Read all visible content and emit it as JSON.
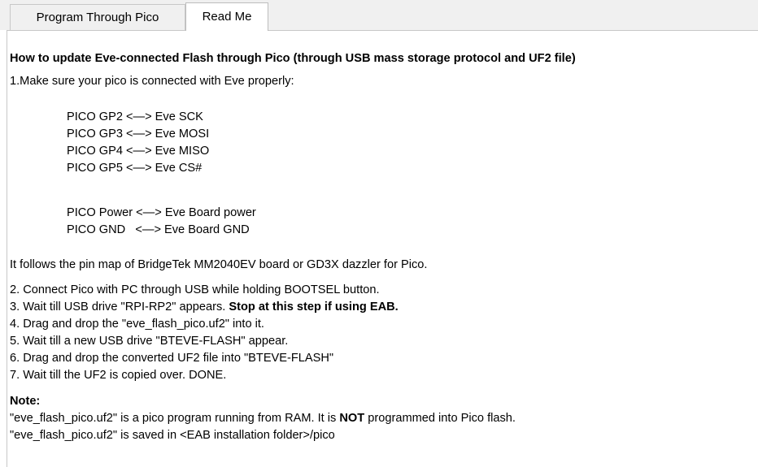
{
  "tabs": [
    {
      "label": "Program Through Pico",
      "active": false
    },
    {
      "label": "Read Me",
      "active": true
    }
  ],
  "readme": {
    "heading": "How to update Eve-connected Flash through Pico (through USB mass storage protocol and UF2 file)",
    "step1": "1.Make sure your pico is connected with Eve properly:",
    "pins": [
      "PICO GP2 <—> Eve SCK",
      "PICO GP3 <—> Eve MOSI",
      "PICO GP4 <—> Eve MISO",
      "PICO GP5 <—> Eve CS#"
    ],
    "power_pins": [
      "PICO Power <—> Eve Board power",
      "PICO GND   <—> Eve Board GND"
    ],
    "pin_map_note": "It follows the pin map of BridgeTek MM2040EV board or GD3X dazzler for Pico.",
    "step2": "2. Connect Pico with PC through USB while holding BOOTSEL button.",
    "step3_text": "3. Wait till USB drive \"RPI-RP2\" appears. ",
    "step3_bold": "Stop at this step if using EAB.",
    "step4": "4. Drag and drop the \"eve_flash_pico.uf2\" into it.",
    "step5": "5. Wait till a new USB drive \"BTEVE-FLASH\" appear.",
    "step6": "6. Drag and drop the converted UF2 file into \"BTEVE-FLASH\"",
    "step7": "7. Wait till the UF2 is copied over. DONE.",
    "note_label": "Note:",
    "note1_pre": "\"eve_flash_pico.uf2\" is a pico program running from RAM. It is ",
    "note1_bold": "NOT",
    "note1_post": " programmed into Pico flash.",
    "note2": "\"eve_flash_pico.uf2\" is saved in <EAB installation folder>/pico"
  }
}
